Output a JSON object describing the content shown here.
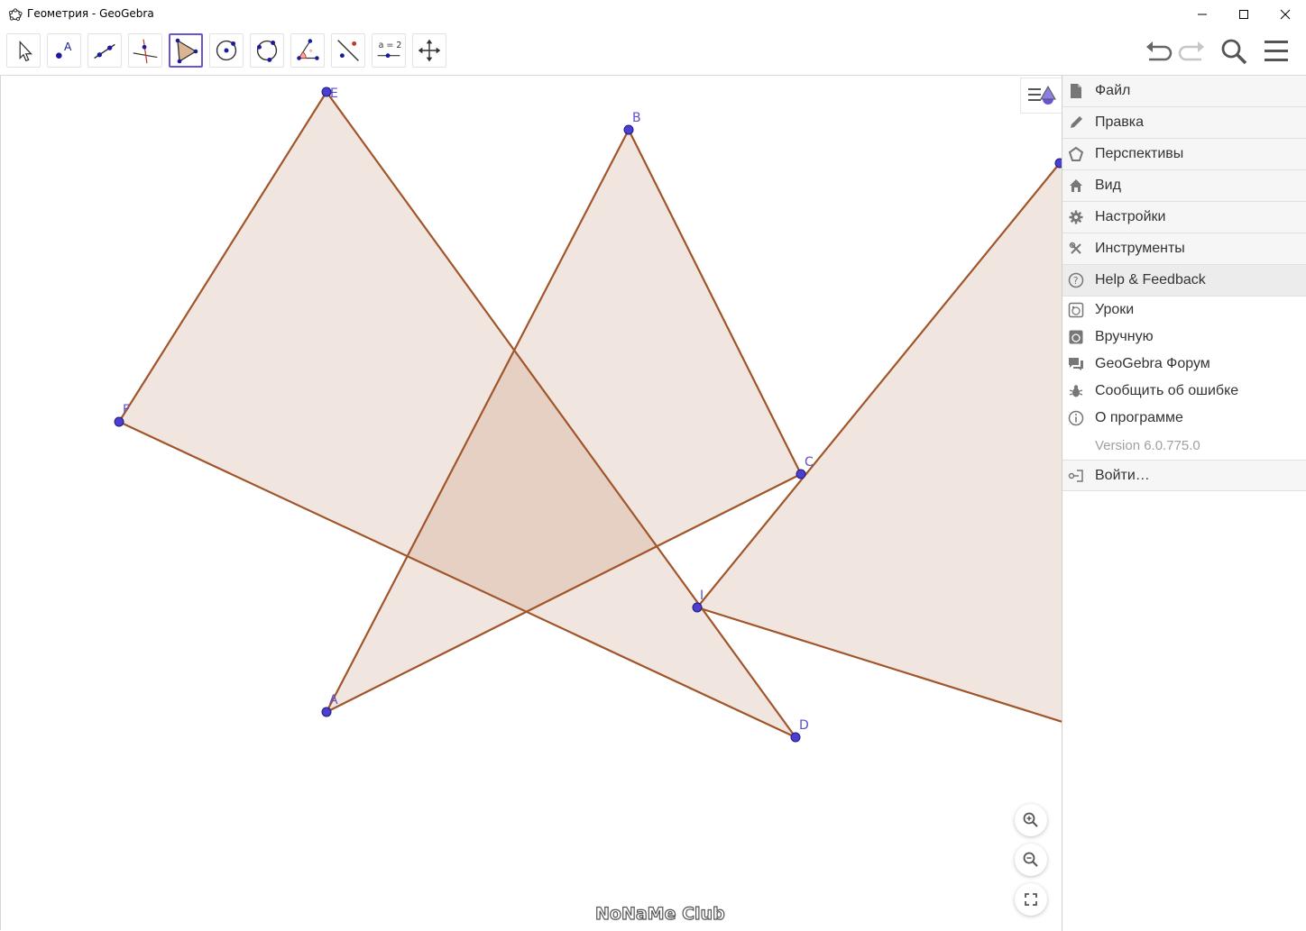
{
  "window": {
    "title": "Геометрия - GeoGebra",
    "controls": [
      "minimize-icon",
      "maximize-icon",
      "close-icon"
    ]
  },
  "toolbar": {
    "tools": [
      {
        "name": "move",
        "icon": "arrow-cursor-icon"
      },
      {
        "name": "point",
        "icon": "point-icon",
        "glyph": "A"
      },
      {
        "name": "segment",
        "icon": "segment-icon"
      },
      {
        "name": "perpendicular-line",
        "icon": "perpendicular-icon"
      },
      {
        "name": "polygon",
        "icon": "polygon-icon",
        "selected": true
      },
      {
        "name": "circle",
        "icon": "circle-center-icon"
      },
      {
        "name": "circle-through-3",
        "icon": "circle-three-points-icon"
      },
      {
        "name": "angle",
        "icon": "angle-icon"
      },
      {
        "name": "reflect",
        "icon": "reflect-icon"
      },
      {
        "name": "slider",
        "icon": "slider-icon",
        "glyph": "a = 2"
      },
      {
        "name": "move-graphics",
        "icon": "move-graphics-icon"
      }
    ],
    "right": [
      "undo-icon",
      "redo-icon",
      "search-icon",
      "menu-icon"
    ]
  },
  "colors": {
    "accent": "#6557d2",
    "polygon_fill": "#f2e2d9",
    "polygon_stroke": "#a0552a",
    "point_fill": "#4c3ed1",
    "label": "#5b4ed0"
  },
  "points": {
    "A": "A",
    "B": "B",
    "C": "C",
    "D": "D",
    "E": "E",
    "F": "F",
    "I": "I"
  },
  "menu": {
    "main_items": [
      {
        "label": "Файл",
        "icon": "file-icon"
      },
      {
        "label": "Правка",
        "icon": "pencil-icon"
      },
      {
        "label": "Перспективы",
        "icon": "perspectives-icon"
      },
      {
        "label": "Вид",
        "icon": "home-icon"
      },
      {
        "label": "Настройки",
        "icon": "gear-icon"
      },
      {
        "label": "Инструменты",
        "icon": "tools-icon"
      },
      {
        "label": "Help & Feedback",
        "icon": "help-icon"
      }
    ],
    "help_items": [
      {
        "label": "Уроки",
        "icon": "tutorials-icon"
      },
      {
        "label": "Вручную",
        "icon": "manual-icon"
      },
      {
        "label": "GeoGebra Форум",
        "icon": "forum-icon"
      },
      {
        "label": "Сообщить об ошибке",
        "icon": "bug-icon"
      },
      {
        "label": "О программе",
        "icon": "info-icon"
      }
    ],
    "version": "Version 6.0.775.0",
    "sign_in": {
      "label": "Войти…",
      "icon": "sign-in-icon"
    }
  },
  "zoom_controls": [
    "zoom-in-icon",
    "zoom-out-icon",
    "fullscreen-icon"
  ],
  "watermark": "NoNaMe Club"
}
